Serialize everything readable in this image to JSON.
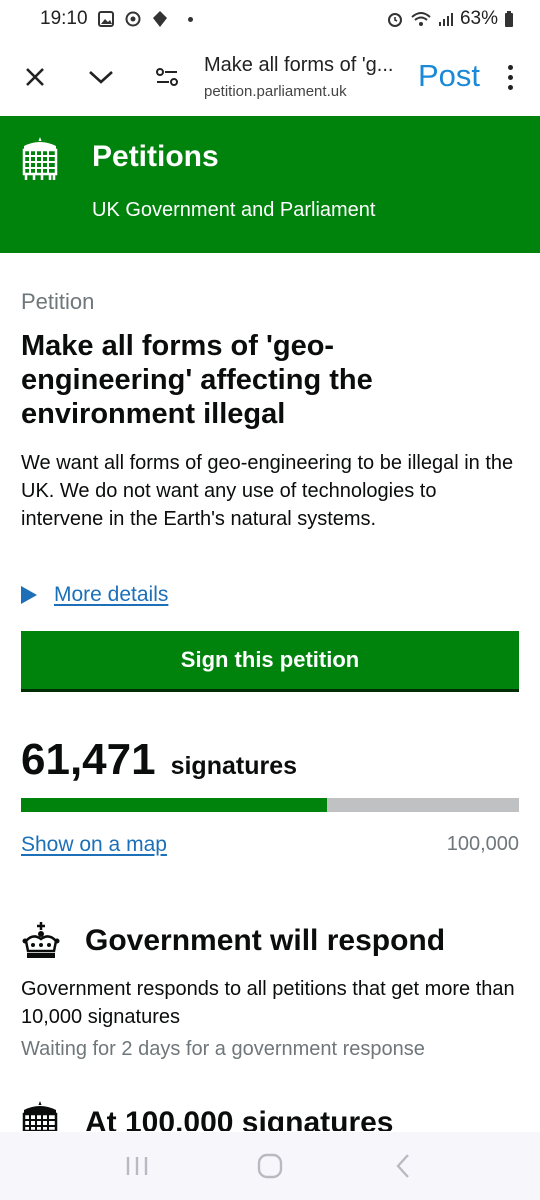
{
  "status_bar": {
    "time": "19:10",
    "battery": "63%"
  },
  "toolbar": {
    "page_title": "Make all forms of 'g...",
    "domain": "petition.parliament.uk",
    "post_label": "Post"
  },
  "header": {
    "title": "Petitions",
    "subtitle": "UK Government and Parliament"
  },
  "petition": {
    "caption": "Petition",
    "title": "Make all forms of 'geo-engineering' affecting the environment illegal",
    "description": "We want all forms of geo-engineering to be illegal in the UK. We do not want any use of technologies to intervene in the Earth's natural systems.",
    "details_label": "More details",
    "sign_label": "Sign this petition",
    "signature_count": "61,471",
    "signature_label": "signatures",
    "progress_fraction": 0.61471,
    "map_label": "Show on a map",
    "target": "100,000"
  },
  "response": {
    "title": "Government will respond",
    "text": "Government responds to all petitions that get more than 10,000 signatures",
    "waiting": "Waiting for 2 days for a government response"
  },
  "debate": {
    "title": "At 100,000 signatures"
  },
  "colors": {
    "brand_green": "#00830d",
    "link_blue": "#1d70b8",
    "post_blue": "#1a8ad8",
    "secondary_grey": "#6f777b"
  }
}
